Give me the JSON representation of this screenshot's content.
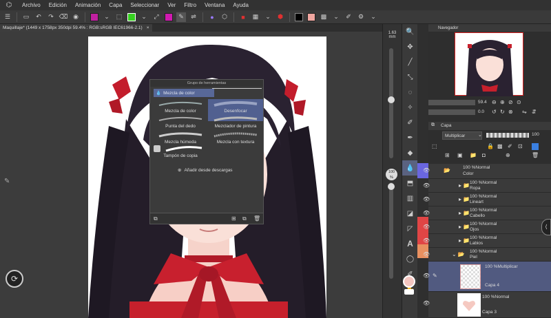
{
  "menu": {
    "items": [
      "Archivo",
      "Edición",
      "Animación",
      "Capa",
      "Seleccionar",
      "Ver",
      "Filtro",
      "Ventana",
      "Ayuda"
    ]
  },
  "doc_tab": {
    "title": "Maquillaje* (1449 x 1758px 350dpi 59.4% : RGB:sRGB IEC61966-2.1)",
    "close": "×"
  },
  "size_readout": {
    "value": "1.63",
    "unit": "mm"
  },
  "opacity_readout": {
    "value": "100",
    "unit": "%"
  },
  "tool_group": {
    "title": "Grupo de herramientas",
    "header": "Mezcla de color",
    "brushes": [
      {
        "label": "Mezcla de color",
        "selected": false
      },
      {
        "label": "Desenfocar",
        "selected": true
      },
      {
        "label": "Punta del dedo",
        "selected": false
      },
      {
        "label": "Mezclador de pintura",
        "selected": false
      },
      {
        "label": "Mezcla húmeda",
        "selected": false
      },
      {
        "label": "Mezcla con textura",
        "selected": false
      },
      {
        "label": "Tampón de copia",
        "selected": false
      }
    ],
    "add_download": "Añadir desde descargas"
  },
  "navigator": {
    "title": "Navegador",
    "zoom": "59.4",
    "rotation": "0.0"
  },
  "layers_panel": {
    "tab": "Capa",
    "blend_mode": "Multiplicar",
    "opacity": "100",
    "layers": [
      {
        "mode": "100 %Normal",
        "name": "Color",
        "type": "folder"
      },
      {
        "mode": "100 %Normal",
        "name": "Ropa",
        "type": "folder"
      },
      {
        "mode": "100 %Normal",
        "name": "Lineart",
        "type": "folder"
      },
      {
        "mode": "100 %Normal",
        "name": "Cabello",
        "type": "folder"
      },
      {
        "mode": "100 %Normal",
        "name": "Ojos",
        "type": "folder"
      },
      {
        "mode": "100 %Normal",
        "name": "Labios",
        "type": "folder"
      },
      {
        "mode": "100 %Normal",
        "name": "Piel",
        "type": "folder"
      },
      {
        "mode": "100 %Multiplicar",
        "name": "Capa 4",
        "type": "layer"
      },
      {
        "mode": "100 %Normal",
        "name": "Capa 3",
        "type": "layer"
      }
    ]
  },
  "colors": {
    "accent": "#5b6fd1",
    "selection": "#515a80",
    "main_color": "#f4c6c0",
    "red": "#cc1f2b"
  }
}
